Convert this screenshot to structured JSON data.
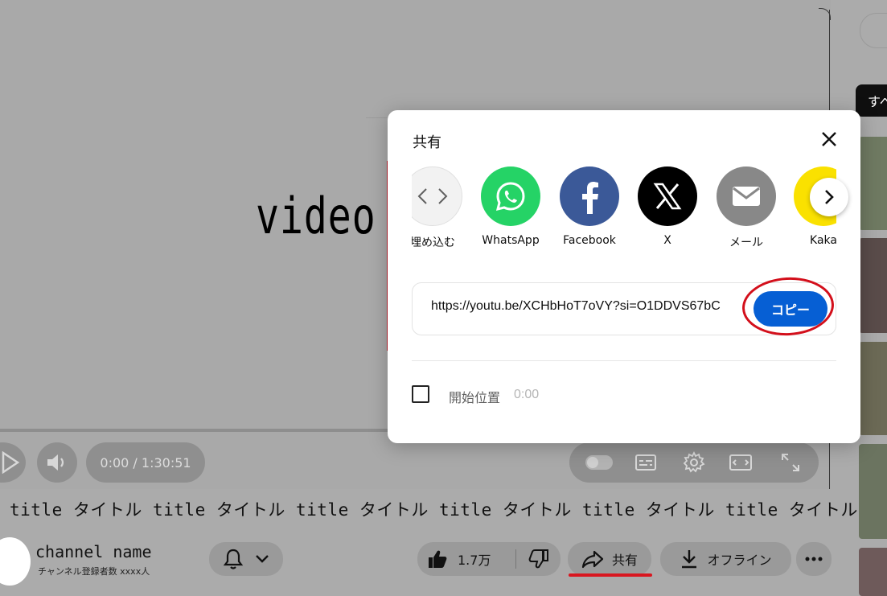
{
  "player": {
    "video_text": "video",
    "time_display": "0:00 / 1:30:51"
  },
  "video_title": "title タイトル title タイトル title タイトル title タイトル title タイトル title タイトル",
  "channel": {
    "name": "channel name",
    "subscribers": "チャンネル登録者数 xxxx人"
  },
  "actions": {
    "like_count": "1.7万",
    "share_label": "共有",
    "download_label": "オフライン"
  },
  "sidebar": {
    "chip_label": "すべ"
  },
  "share_dialog": {
    "title": "共有",
    "targets": [
      {
        "label": "埋め込む",
        "icon": "embed-icon",
        "color": "#f2f2f2"
      },
      {
        "label": "WhatsApp",
        "icon": "whatsapp-icon",
        "color": "#25d366"
      },
      {
        "label": "Facebook",
        "icon": "facebook-icon",
        "color": "#3b5998"
      },
      {
        "label": "X",
        "icon": "x-icon",
        "color": "#000000"
      },
      {
        "label": "メール",
        "icon": "mail-icon",
        "color": "#888888"
      },
      {
        "label": "Kaka",
        "icon": "kakao-icon",
        "color": "#fae100"
      }
    ],
    "url": "https://youtu.be/XCHbHoT7oVY?si=O1DDVS67bC",
    "copy_label": "コピー",
    "start_at_label": "開始位置",
    "start_at_time": "0:00",
    "accent_color": "#065fd4",
    "highlight_color": "#d30f1b"
  }
}
